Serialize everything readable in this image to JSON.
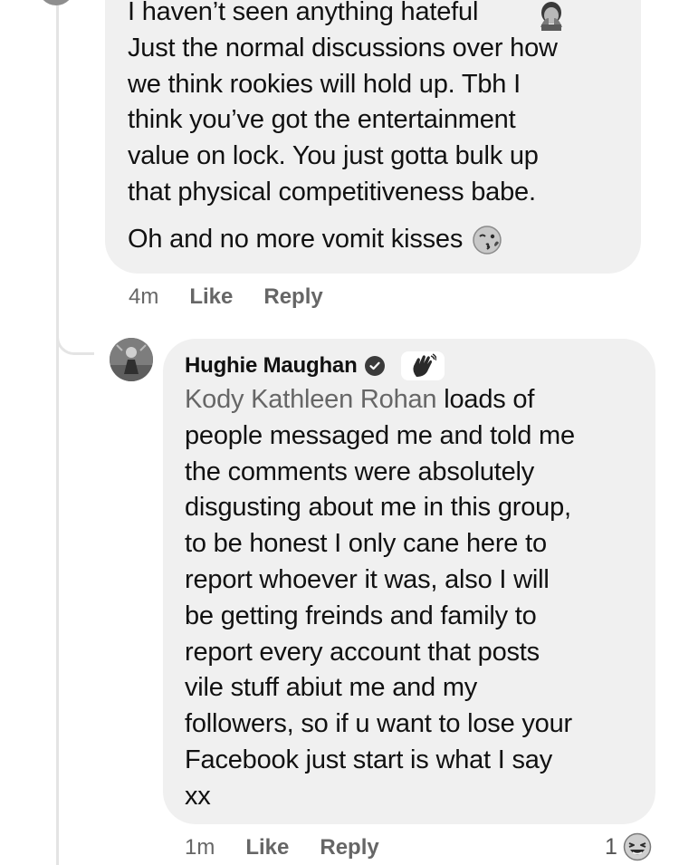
{
  "comment_1": {
    "text_lines": [
      "I haven’t seen anything hateful",
      "Just the normal discussions over how",
      "we think rookies will hold up. Tbh I",
      "think you’ve got the entertainment",
      "value on lock. You just gotta bulk up",
      "that physical competitiveness babe."
    ],
    "second_paragraph": "Oh and no more vomit kisses",
    "emoji_1": "person-facepalm-emoji",
    "emoji_2": "kissing-wink-emoji",
    "time": "4m",
    "like_label": "Like",
    "reply_label": "Reply"
  },
  "comment_2": {
    "author": "Hughie Maughan",
    "badge_icon": "verified-check-icon",
    "wave_icon": "waving-hand-icon",
    "mention": "Kody Kathleen Rohan",
    "first_line_rest": " loads of",
    "text_lines": [
      "people messaged me and told me",
      "the comments were absolutely",
      "disgusting about me in this group,",
      "to be honest I only cane here to",
      "report whoever it was, also I will",
      "be getting freinds and family to",
      "report every account that posts",
      "vile stuff abiut me and my",
      "followers, so if u want to lose your",
      "Facebook just start is what I say",
      "xx"
    ],
    "time": "1m",
    "like_label": "Like",
    "reply_label": "Reply",
    "reaction_count": "1",
    "reaction_icon": "laughing-emoji"
  }
}
